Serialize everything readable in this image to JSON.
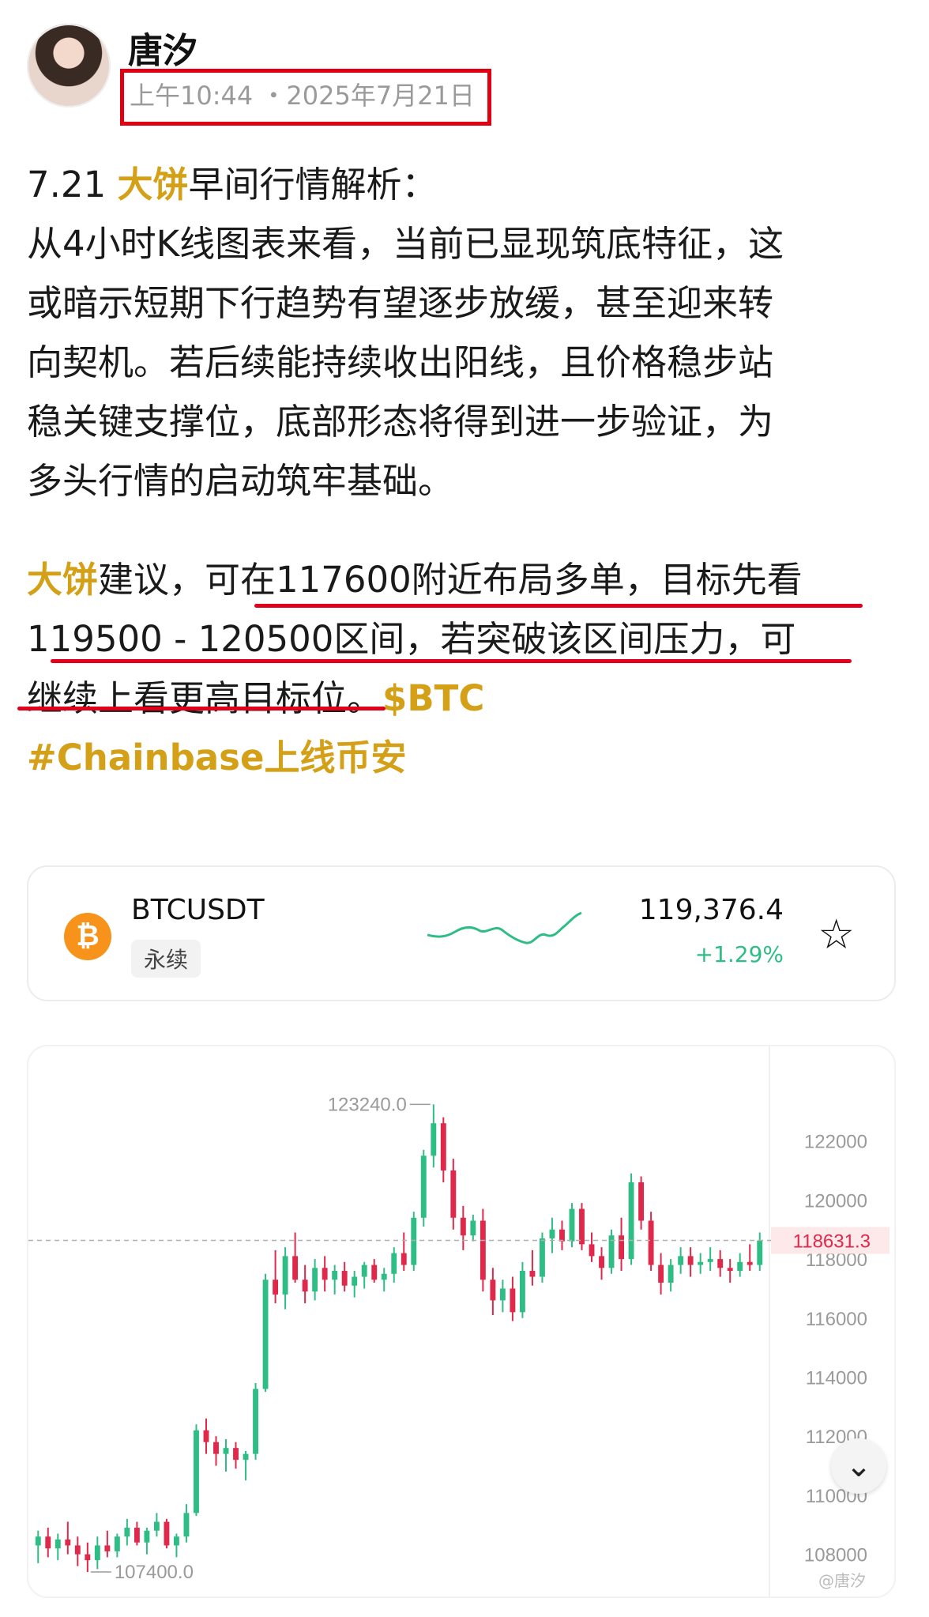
{
  "post": {
    "author": "唐汐",
    "time": "上午10:44 ・2025年7月21日",
    "title_pre": "7.21 ",
    "title_hl": "大饼",
    "title_post": "早间行情解析：",
    "body_lines": [
      "从4小时K线图表来看，当前已显现筑底特征，这",
      "或暗示短期下行趋势有望逐步放缓，甚至迎来转",
      "向契机。若后续能持续收出阳线，且价格稳步站",
      "稳关键支撑位，底部形态将得到进一步验证，为",
      "多头行情的启动筑牢基础。"
    ],
    "advice_hl": "大饼",
    "advice_line1_rest": "建议，可在117600附近布局多单，目标先看",
    "advice_line2": "119500 - 120500区间，若突破该区间压力，可",
    "advice_line3": "继续上看更高目标位。",
    "tag_btc": "$BTC",
    "hashtag": "#Chainbase上线币安",
    "accent_color": "#d4a017",
    "annotation_color": "#e00012"
  },
  "ticker": {
    "symbol": "BTCUSDT",
    "contract_type": "永续",
    "price": "119,376.4",
    "change": "+1.29%",
    "logo_icon": "bitcoin-icon",
    "favorite_icon": "star-outline-icon",
    "up_color": "#2ebd85"
  },
  "chart_data": {
    "type": "candlestick",
    "ylim": [
      107000,
      124400
    ],
    "y_ticks": [
      "122000",
      "120000",
      "118000",
      "116000",
      "114000",
      "112000",
      "110000",
      "108000"
    ],
    "high_label": "123240.0",
    "low_label": "107400.0",
    "current_price_label": "118631.3",
    "current_price": 118631.3,
    "grid": false,
    "candles": [
      [
        108300,
        108800,
        107700,
        108600
      ],
      [
        108600,
        108900,
        107900,
        108200
      ],
      [
        108200,
        108700,
        107800,
        108500
      ],
      [
        108500,
        109100,
        108000,
        108300
      ],
      [
        108300,
        108600,
        107600,
        108000
      ],
      [
        108000,
        108400,
        107400,
        107800
      ],
      [
        107800,
        108600,
        107500,
        108300
      ],
      [
        108300,
        108800,
        107900,
        108100
      ],
      [
        108100,
        108700,
        107900,
        108600
      ],
      [
        108600,
        109200,
        108300,
        108900
      ],
      [
        108900,
        109100,
        108300,
        108400
      ],
      [
        108400,
        108900,
        108000,
        108800
      ],
      [
        108800,
        109400,
        108600,
        109100
      ],
      [
        109100,
        109200,
        108200,
        108300
      ],
      [
        108300,
        108700,
        107900,
        108600
      ],
      [
        108600,
        109700,
        108400,
        109400
      ],
      [
        109400,
        112400,
        109300,
        112200
      ],
      [
        112200,
        112600,
        111400,
        111800
      ],
      [
        111800,
        112000,
        111000,
        111400
      ],
      [
        111400,
        111900,
        110800,
        111600
      ],
      [
        111600,
        111800,
        110900,
        111200
      ],
      [
        111200,
        111500,
        110500,
        111400
      ],
      [
        111400,
        113800,
        111200,
        113600
      ],
      [
        113600,
        117500,
        113500,
        117300
      ],
      [
        117300,
        118300,
        116500,
        116800
      ],
      [
        116800,
        118400,
        116300,
        118100
      ],
      [
        118100,
        118900,
        117200,
        117300
      ],
      [
        117300,
        117800,
        116500,
        116900
      ],
      [
        116900,
        118000,
        116600,
        117700
      ],
      [
        117700,
        118100,
        116900,
        117300
      ],
      [
        117300,
        117800,
        116800,
        117600
      ],
      [
        117600,
        117900,
        116900,
        117100
      ],
      [
        117100,
        117600,
        116700,
        117400
      ],
      [
        117400,
        117900,
        117000,
        117800
      ],
      [
        117800,
        118000,
        117200,
        117300
      ],
      [
        117300,
        117700,
        116900,
        117500
      ],
      [
        117500,
        118400,
        117200,
        118200
      ],
      [
        118200,
        118900,
        117600,
        117800
      ],
      [
        117800,
        119600,
        117600,
        119400
      ],
      [
        119400,
        121700,
        119100,
        121500
      ],
      [
        121500,
        123240,
        121100,
        122600
      ],
      [
        122600,
        122800,
        120600,
        121000
      ],
      [
        121000,
        121400,
        119000,
        119400
      ],
      [
        119400,
        119800,
        118300,
        118800
      ],
      [
        118800,
        119500,
        118600,
        119300
      ],
      [
        119300,
        119700,
        116900,
        117300
      ],
      [
        117300,
        117700,
        116100,
        116600
      ],
      [
        116600,
        117300,
        116200,
        117000
      ],
      [
        117000,
        117400,
        115900,
        116200
      ],
      [
        116200,
        117900,
        116000,
        117600
      ],
      [
        117600,
        118300,
        117100,
        117400
      ],
      [
        117400,
        118900,
        117200,
        118700
      ],
      [
        118700,
        119400,
        118200,
        119000
      ],
      [
        119000,
        119300,
        118300,
        118600
      ],
      [
        118600,
        119900,
        118400,
        119700
      ],
      [
        119700,
        119900,
        118300,
        118500
      ],
      [
        118500,
        118900,
        117900,
        118100
      ],
      [
        118100,
        118400,
        117300,
        117700
      ],
      [
        117700,
        119000,
        117500,
        118800
      ],
      [
        118800,
        119400,
        117600,
        118000
      ],
      [
        118000,
        120900,
        117800,
        120600
      ],
      [
        120600,
        120800,
        119000,
        119300
      ],
      [
        119300,
        119600,
        117600,
        117800
      ],
      [
        117800,
        118200,
        116800,
        117200
      ],
      [
        117200,
        118000,
        116900,
        117800
      ],
      [
        117800,
        118400,
        117500,
        118100
      ],
      [
        118100,
        118400,
        117400,
        117800
      ],
      [
        117800,
        118200,
        117500,
        117900
      ],
      [
        117900,
        118400,
        117600,
        118000
      ],
      [
        118000,
        118300,
        117400,
        117700
      ],
      [
        117700,
        118000,
        117200,
        117600
      ],
      [
        117600,
        118200,
        117400,
        117900
      ],
      [
        117900,
        118500,
        117600,
        117800
      ],
      [
        117800,
        118900,
        117600,
        118630
      ]
    ]
  },
  "controls": {
    "scroll_down_icon": "double-chevron-down-icon"
  },
  "watermark": "@唐汐"
}
